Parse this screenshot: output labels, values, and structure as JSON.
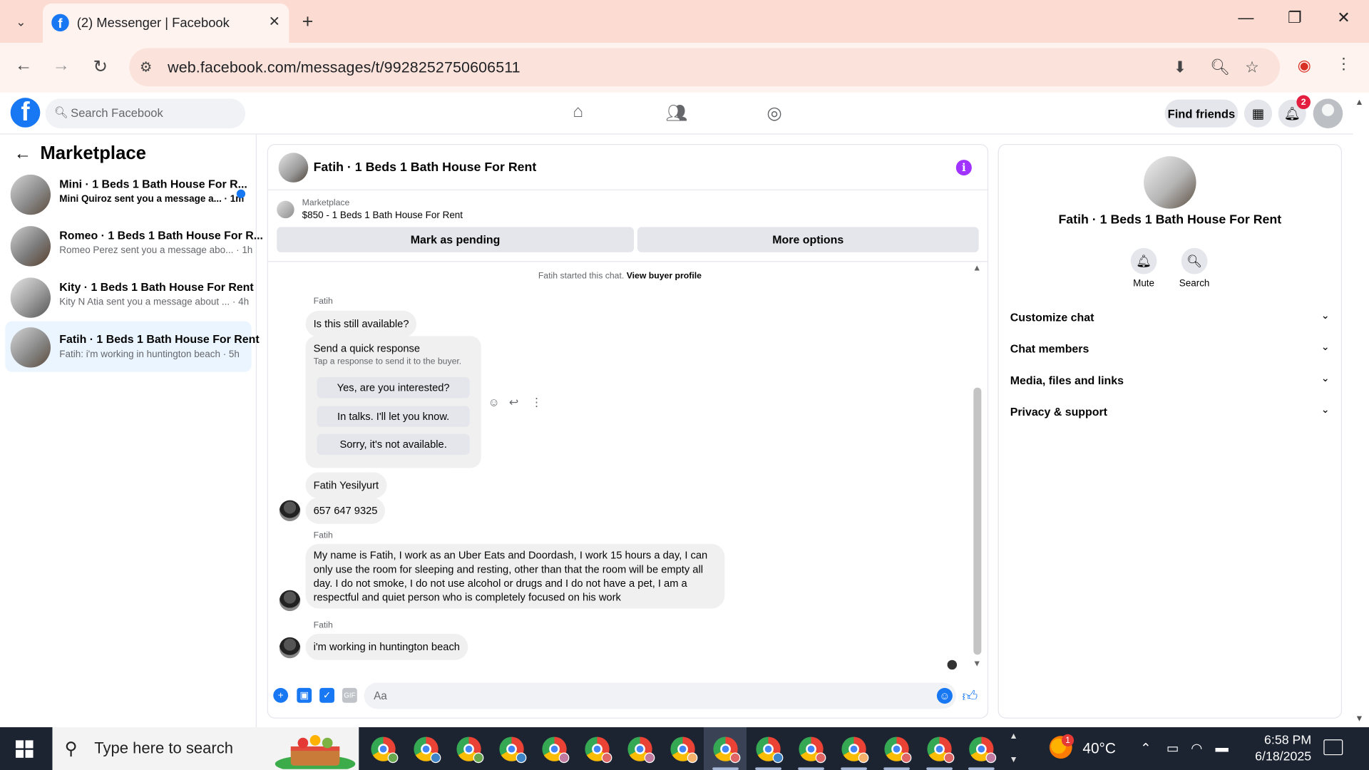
{
  "browser": {
    "tab_title": "(2) Messenger | Facebook",
    "url": "web.facebook.com/messages/t/9928252750606511"
  },
  "fb_header": {
    "search_placeholder": "Search Facebook",
    "find_friends": "Find friends",
    "notification_count": "2"
  },
  "sidebar": {
    "title": "Marketplace",
    "conversations": [
      {
        "name": "Mini · 1 Beds 1 Bath House For R...",
        "preview": "Mini Quiroz sent you a message a... · 1m",
        "unread": true
      },
      {
        "name": "Romeo · 1 Beds 1 Bath House For R...",
        "preview": "Romeo Perez sent you a message abo... · 1h",
        "unread": false
      },
      {
        "name": "Kity · 1 Beds 1 Bath House For Rent",
        "preview": "Kity N Atia sent you a message about ... · 4h",
        "unread": false
      },
      {
        "name": "Fatih · 1 Beds 1 Bath House For Rent",
        "preview": "Fatih: i'm working in huntington beach · 5h",
        "unread": false,
        "active": true
      }
    ]
  },
  "chat": {
    "title": "Fatih · 1 Beds 1 Bath House For Rent",
    "listing_source": "Marketplace",
    "listing": "$850 - 1 Beds 1 Bath House For Rent",
    "mark_pending": "Mark as pending",
    "more_options": "More options",
    "started_text": "Fatih started this chat.",
    "view_profile": "View buyer profile",
    "sender_1": "Fatih",
    "msg_available": "Is this still available?",
    "quick_title": "Send a quick response",
    "quick_sub": "Tap a response to send it to the buyer.",
    "quick_options": [
      "Yes, are you interested?",
      "In talks. I'll let you know.",
      "Sorry, it's not available."
    ],
    "msg_name": "Fatih Yesilyurt",
    "msg_phone": "657 647 9325",
    "sender_2": "Fatih",
    "msg_long": "My name is Fatih, I work as an Uber Eats and Doordash, I work 15 hours a day, I can only use the room for sleeping and resting, other than that the room will be empty all day. I do not smoke, I do not use alcohol or drugs and I do not have a pet, I am a respectful and quiet person who is completely focused on his work",
    "sender_3": "Fatih",
    "msg_last": "i'm working in huntington beach",
    "composer_placeholder": "Aa"
  },
  "right_panel": {
    "name": "Fatih · 1 Beds 1 Bath House For Rent",
    "mute": "Mute",
    "search": "Search",
    "sections": [
      "Customize chat",
      "Chat members",
      "Media, files and links",
      "Privacy & support"
    ]
  },
  "taskbar": {
    "search_placeholder": "Type here to search",
    "weather_temp": "40°C",
    "weather_badge": "1",
    "time": "6:58 PM",
    "date": "6/18/2025"
  },
  "colors": {
    "facebook_blue": "#1877f2",
    "tab_bar": "#fcdcd2",
    "info_purple": "#a033ff",
    "taskbar": "#1c2331"
  }
}
